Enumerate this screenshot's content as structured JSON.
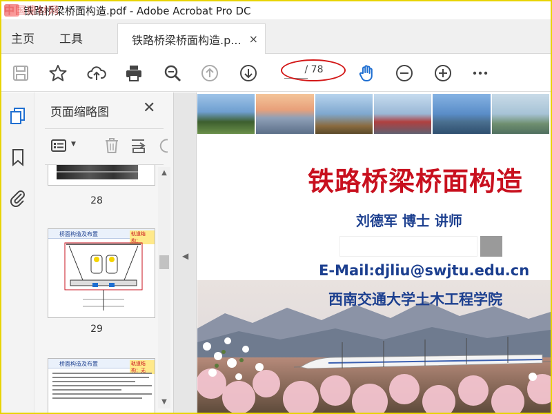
{
  "window": {
    "title": "铁路桥梁桥面构造.pdf - Adobe Acrobat Pro DC",
    "watermark": "中国建材网"
  },
  "tabs": {
    "home": "主页",
    "tools": "工具",
    "document": "铁路桥梁桥面构造.p...",
    "close": "×"
  },
  "toolbar": {
    "page_total": "/ 78",
    "icons": [
      "save-icon",
      "bookmark-star-icon",
      "upload-cloud-icon",
      "print-icon",
      "zoom-icon",
      "prev-page-icon",
      "next-page-icon",
      "hand-tool-icon",
      "zoom-out-icon",
      "zoom-in-icon",
      "more-icon"
    ]
  },
  "thumbnails_panel": {
    "title": "页面缩略图",
    "close": "✕",
    "pages": [
      {
        "label": "28"
      },
      {
        "label": "29",
        "header": "桥面构造及布置",
        "tag": "轨道结构："
      },
      {
        "label": "",
        "header": "桥面构造及布置",
        "tag": "轨道结构：无"
      }
    ]
  },
  "document": {
    "title": "铁路桥梁桥面构造",
    "author": "刘德军  博士  讲师",
    "email": "E-Mail:djliu@swjtu.edu.cn",
    "school": "西南交通大学土木工程学院"
  },
  "colors": {
    "accent_blue": "#1f6fd1",
    "title_red": "#c8101e",
    "text_blue": "#1c3f8f",
    "annotation_red": "#d31818"
  }
}
